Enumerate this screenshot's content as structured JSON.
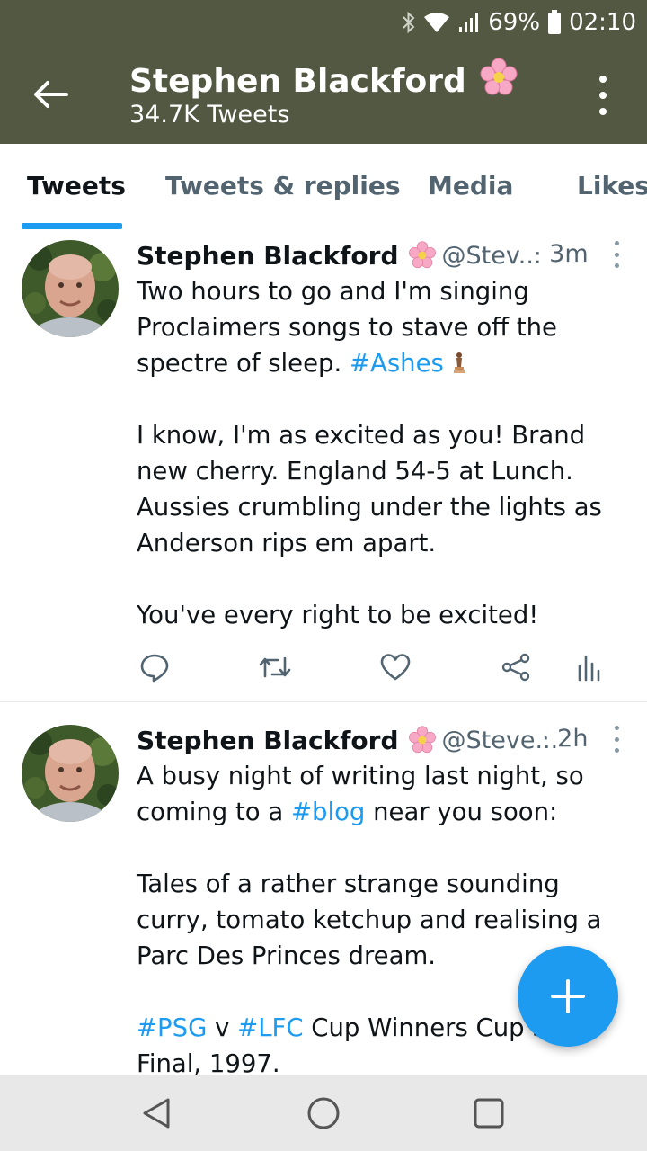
{
  "status_bar": {
    "battery": "69%",
    "time": "02:10",
    "icons": [
      "bluetooth-icon",
      "wifi-icon",
      "signal-icon",
      "battery-icon"
    ]
  },
  "header": {
    "title": "Stephen Blackford",
    "subtitle": "34.7K Tweets",
    "title_emoji": "cherry-blossom-icon"
  },
  "tabs": [
    {
      "label": "Tweets",
      "active": true
    },
    {
      "label": "Tweets & replies",
      "active": false
    },
    {
      "label": "Media",
      "active": false
    },
    {
      "label": "Likes",
      "active": false
    }
  ],
  "tweets": [
    {
      "name": "Stephen Blackford",
      "handle": "@Stev...",
      "time": "· 3m",
      "lines": {
        "p1a": "Two hours to go and I'm singing Proclaimers songs to stave off the spectre of sleep. ",
        "p1tag": "#Ashes",
        "p2": "I know, I'm as excited as you! Brand new cherry. England 54-5 at Lunch. Aussies crumbling under the lights as Anderson rips em apart.",
        "p3": "You've every right to be excited!"
      }
    },
    {
      "name": "Stephen Blackford",
      "handle": "@Steve...",
      "time": "· 2h",
      "lines": {
        "p1a": "A busy night of writing last night, so coming to a ",
        "p1tag": "#blog",
        "p1b": " near you soon:",
        "p2": "Tales of a rather strange sounding curry, tomato ketchup and realising a Parc Des Princes dream.",
        "p3tag1": "#PSG",
        "p3mid": " v ",
        "p3tag2": "#LFC",
        "p3b": " Cup Winners Cup Semi Final, 1997."
      }
    }
  ],
  "colors": {
    "header_bg": "#535842",
    "accent": "#1d9bf0",
    "muted": "#536471"
  }
}
